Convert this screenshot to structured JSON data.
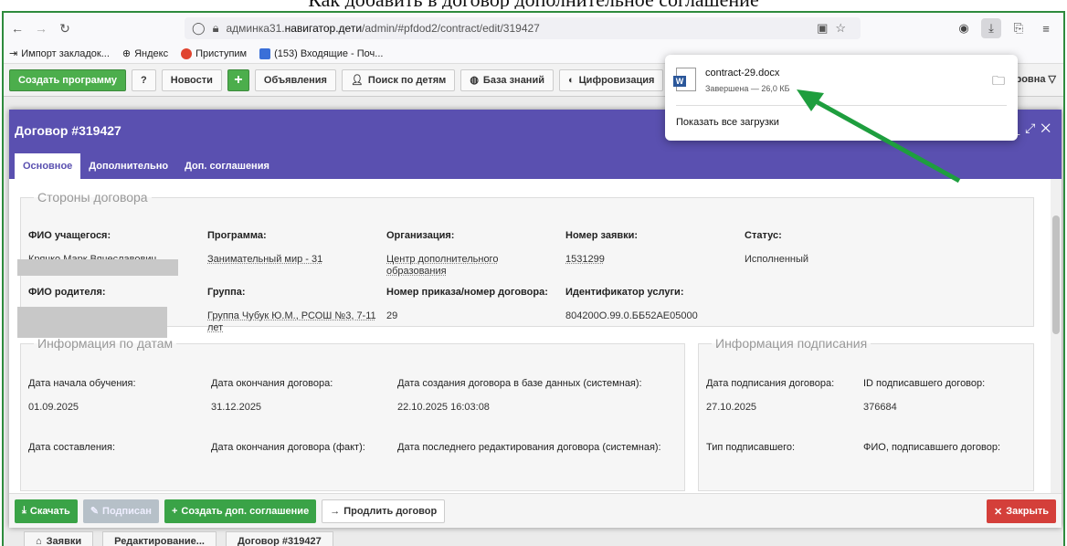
{
  "heading_fragment": "Как добавить в договор дополнительное соглашение",
  "browser": {
    "url_prefix": "админка31.",
    "url_domain": "навигатор.дети",
    "url_path": "/admin/#pfdod2/contract/edit/319427"
  },
  "bookmarks": [
    {
      "label": "Импорт закладок..."
    },
    {
      "label": "Яндекс"
    },
    {
      "label": "Приступим"
    },
    {
      "label": "(153) Входящие - Поч..."
    }
  ],
  "toolbar": {
    "create_program": "Создать программу",
    "news": "Новости",
    "announcements": "Объявления",
    "search_children": "Поиск по детям",
    "knowledge_base": "База знаний",
    "digitalization": "Цифровизация",
    "user_menu": "дровна"
  },
  "modal": {
    "title": "Договор #319427",
    "tabs": [
      "Основное",
      "Дополнительно",
      "Доп. соглашения"
    ]
  },
  "parties": {
    "legend": "Стороны договора",
    "student_label": "ФИО учащегося:",
    "student_value": "Крячко Марк Вячеславович",
    "program_label": "Программа:",
    "program_value": "Занимательный мир - 31",
    "org_label": "Организация:",
    "org_value": "Центр дополнительного образования",
    "request_label": "Номер заявки:",
    "request_value": "1531299",
    "status_label": "Статус:",
    "status_value": "Исполненный",
    "parent_label": "ФИО родителя:",
    "group_label": "Группа:",
    "group_value": "Группа Чубук Ю.М., РСОШ №3, 7-11 лет",
    "order_label": "Номер приказа/номер договора:",
    "order_value": "29",
    "service_label": "Идентификатор услуги:",
    "service_value": "804200О.99.0.ББ52АЕ05000"
  },
  "dates": {
    "legend": "Информация по датам",
    "start_label": "Дата начала обучения:",
    "start_value": "01.09.2025",
    "end_label": "Дата окончания договора:",
    "end_value": "31.12.2025",
    "created_label": "Дата создания договора в базе данных (системная):",
    "created_value": "22.10.2025 16:03:08",
    "drawn_label": "Дата составления:",
    "end_fact_label": "Дата окончания договора (факт):",
    "edited_label": "Дата последнего редактирования договора (системная):"
  },
  "signing": {
    "legend": "Информация подписания",
    "sign_date_label": "Дата подписания договора:",
    "sign_date_value": "27.10.2025",
    "signer_id_label": "ID подписавшего договор:",
    "signer_id_value": "376684",
    "signer_type_label": "Тип подписавшего:",
    "signer_name_label": "ФИО, подписавшего договор:"
  },
  "footer": {
    "download": "Скачать",
    "signed": "Подписан",
    "create_supplement": "Создать доп. соглашение",
    "extend": "Продлить договор",
    "close": "Закрыть"
  },
  "taskbar": [
    "Заявки",
    "Редактирование...",
    "Договор #319427"
  ],
  "download_popup": {
    "filename": "contract-29.docx",
    "status": "Завершена — 26,0 КБ",
    "show_all": "Показать все загрузки"
  },
  "colors": {
    "accent_purple": "#5a50b0",
    "green": "#3aa347",
    "red": "#d43f3a",
    "arrow": "#1e9e3e"
  }
}
